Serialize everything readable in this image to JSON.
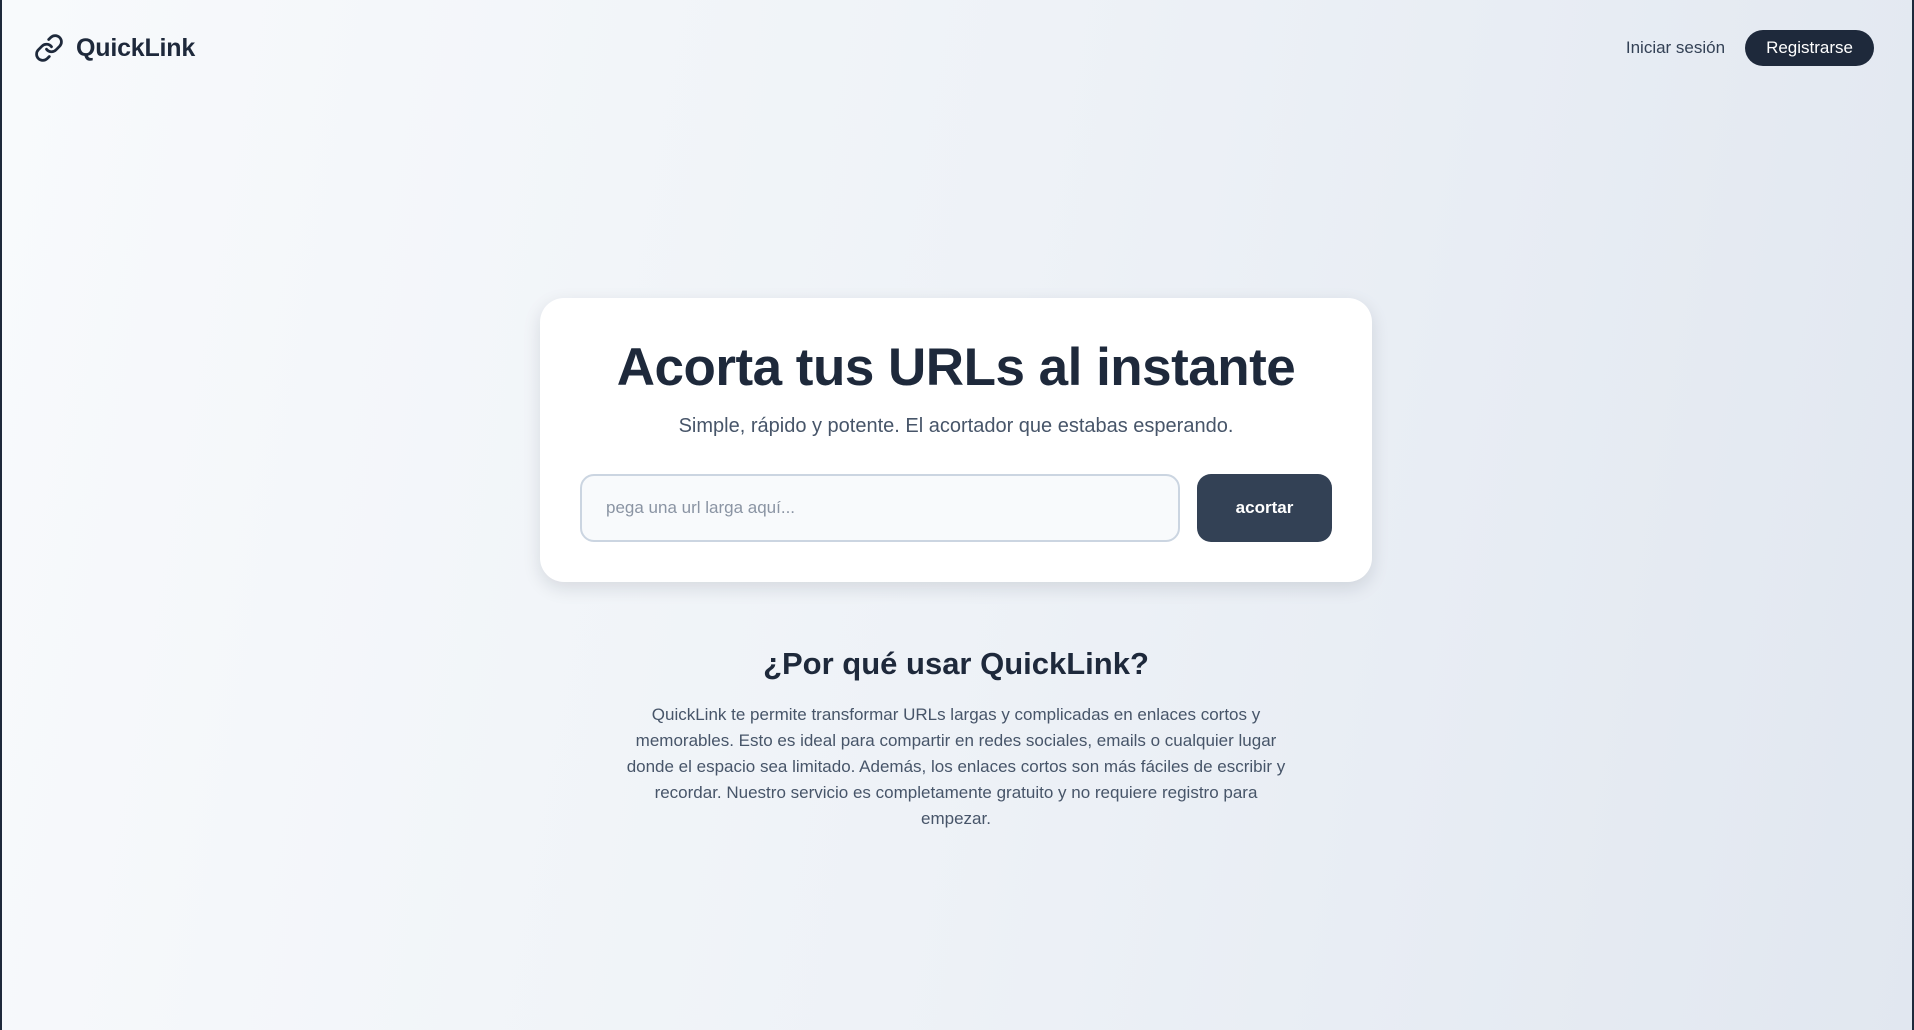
{
  "header": {
    "brand": {
      "name": "QuickLink",
      "icon": "link-icon"
    },
    "nav": {
      "login_label": "Iniciar sesión",
      "register_label": "Registrarse"
    }
  },
  "hero": {
    "title": "Acorta tus URLs al instante",
    "subtitle": "Simple, rápido y potente. El acortador que estabas esperando.",
    "url_input": {
      "value": "",
      "placeholder": "pega una url larga aquí..."
    },
    "shorten_label": "acortar"
  },
  "why": {
    "title": "¿Por qué usar QuickLink?",
    "text": "QuickLink te permite transformar URLs largas y complicadas en enlaces cortos y memorables. Esto es ideal para compartir en redes sociales, emails o cualquier lugar donde el espacio sea limitado. Además, los enlaces cortos son más fáciles de escribir y recordar. Nuestro servicio es completamente gratuito y no requiere registro para empezar."
  },
  "colors": {
    "primary_dark": "#1e293b",
    "button_slate": "#334155",
    "text_muted": "#475569"
  }
}
